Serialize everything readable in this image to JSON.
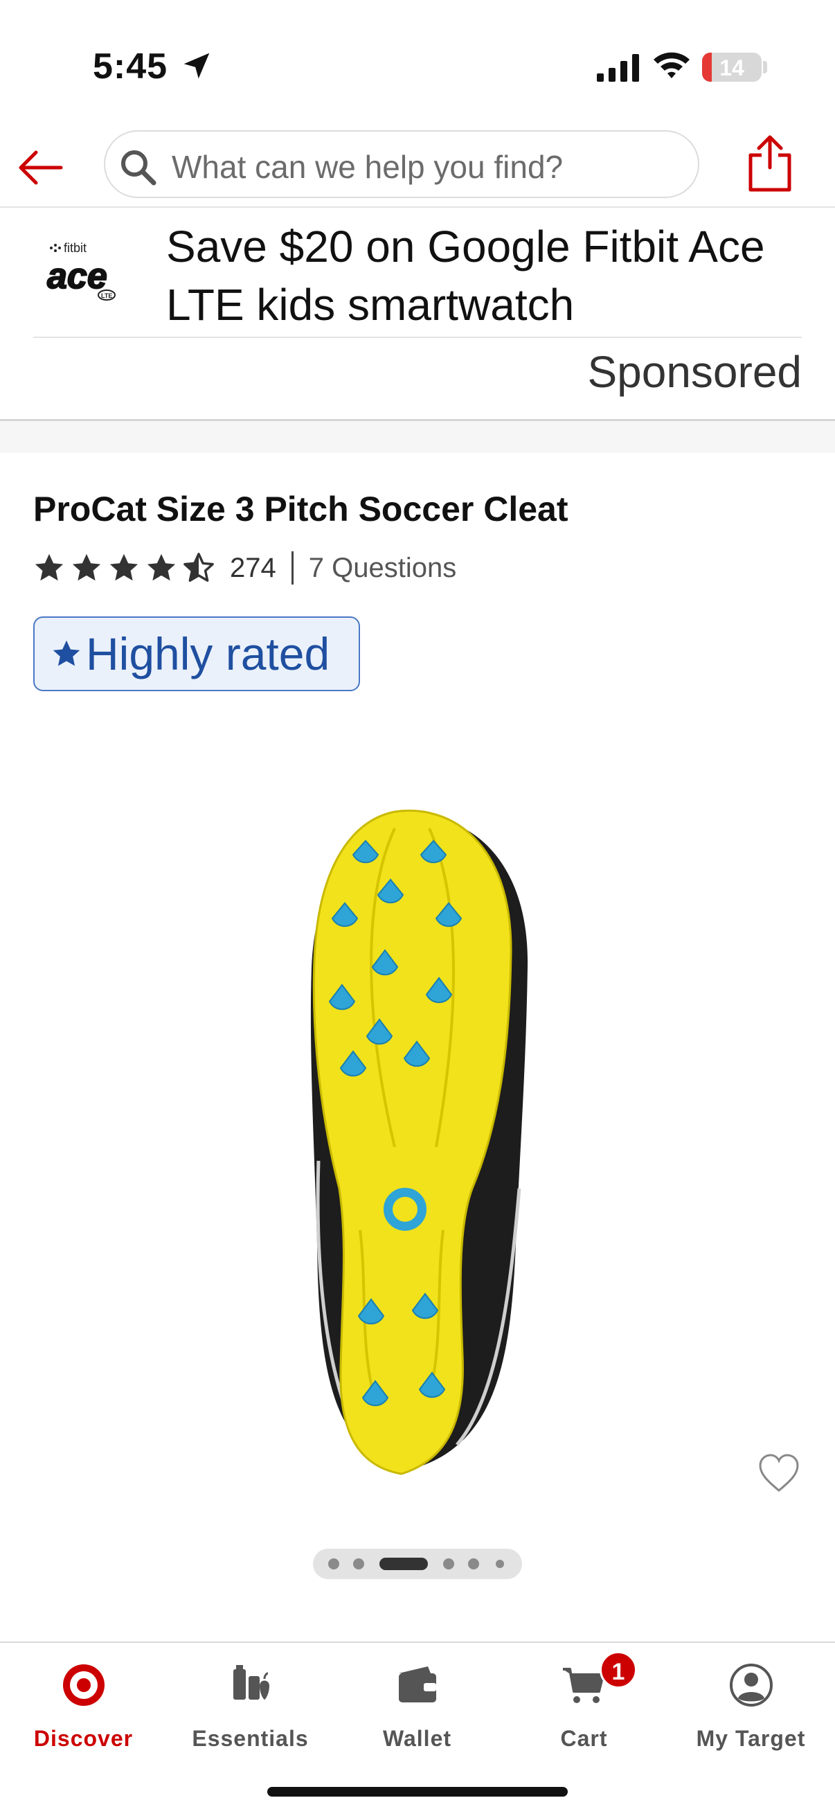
{
  "status_bar": {
    "time": "5:45",
    "battery": "14"
  },
  "search": {
    "placeholder": "What can we help you find?"
  },
  "ad": {
    "title": "Save $20 on Google Fitbit Ace LTE kids smartwatch",
    "sponsored_label": "Sponsored",
    "logo_brand": "fitbit",
    "logo_name": "ace",
    "logo_sub": "LTE"
  },
  "product": {
    "title": "ProCat Size 3 Pitch Soccer Cleat",
    "rating": 4.5,
    "review_count": "274",
    "questions": "7 Questions",
    "badge": "Highly rated",
    "image_count": 6,
    "active_image": 3
  },
  "colors": {
    "brand": "#cc0000",
    "badge_text": "#1f4fa0",
    "cleat_yellow": "#f1e21c",
    "stud_blue": "#2fa4d6"
  },
  "bottom_nav": {
    "items": [
      {
        "label": "Discover",
        "icon": "target-logo-icon"
      },
      {
        "label": "Essentials",
        "icon": "essentials-icon"
      },
      {
        "label": "Wallet",
        "icon": "wallet-icon"
      },
      {
        "label": "Cart",
        "icon": "cart-icon"
      },
      {
        "label": "My Target",
        "icon": "account-icon"
      }
    ],
    "cart_count": "1"
  }
}
